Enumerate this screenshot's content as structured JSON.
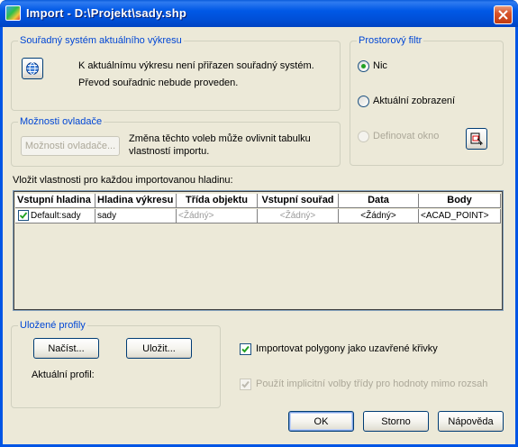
{
  "window": {
    "title": "Import - D:\\Projekt\\sady.shp"
  },
  "coord_system": {
    "label": "Souřadný systém aktuálního výkresu",
    "line1": "K aktuálnímu výkresu není přiřazen souřadný systém.",
    "line2": "Převod souřadnic nebude proveden."
  },
  "spatial_filter": {
    "label": "Prostorový filtr",
    "options": [
      {
        "label": "Nic",
        "checked": true,
        "enabled": true
      },
      {
        "label": "Aktuální zobrazení",
        "checked": false,
        "enabled": true
      },
      {
        "label": "Definovat okno",
        "checked": false,
        "enabled": false
      }
    ]
  },
  "driver_options": {
    "label": "Možnosti ovladače",
    "button_label": "Možnosti ovladače...",
    "note_line1": "Změna těchto voleb může ovlivnit tabulku",
    "note_line2": "vlastností importu."
  },
  "layers": {
    "caption": "Vložit vlastnosti pro každou importovanou hladinu:",
    "columns": [
      "Vstupní hladina",
      "Hladina výkresu",
      "Třída objektu",
      "Vstupní souřad",
      "Data",
      "Body"
    ],
    "rows": [
      {
        "input_layer": "Default:sady",
        "checked": true,
        "drawing_layer": "sady",
        "object_class": "<Žádný>",
        "input_coord": "<Žádný>",
        "data": "<Žádný>",
        "points": "<ACAD_POINT>"
      }
    ]
  },
  "profiles": {
    "label": "Uložené profily",
    "load_label": "Načíst...",
    "save_label": "Uložit...",
    "current_label": "Aktuální profil:"
  },
  "options": {
    "import_polygons": {
      "label": "Importovat polygony jako uzavřené křivky",
      "checked": true,
      "enabled": true
    },
    "implicit_class": {
      "label": "Použít implicitní volby třídy pro hodnoty mimo rozsah",
      "checked": true,
      "enabled": false
    }
  },
  "buttons": {
    "ok": "OK",
    "cancel": "Storno",
    "help": "Nápověda"
  }
}
